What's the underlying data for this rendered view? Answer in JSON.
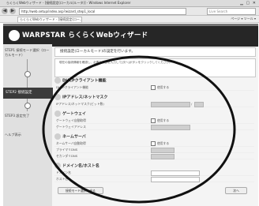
{
  "browser": {
    "title": "らくらくWebウィザード - [接続設定(ローカル(ルータ)] - Windows Internet Explorer",
    "address": "http://web.setup/index.asp?wizard_step1_local",
    "search_placeholder": "Live Search",
    "tab_label": "らくらくWebウィザード - [接続設定(ロー...",
    "tools": "ページ ▾  ツール ▾"
  },
  "app": {
    "title": "WARPSTAR らくらくWebウィザード",
    "sidebar": {
      "step1": "STEP1 接続モード選択（ローカルモード）",
      "step2": "STEP2 接続設定",
      "step3": "STEP3 設定完了",
      "help": "ヘルプ表示"
    },
    "content": {
      "title": "接続設定(ローカルモード)の設定を行います。",
      "intro": "現在の接続情報を確認し、必要な項目を入力して[次へ]ボタンをクリックしてください。",
      "sections": {
        "dhcp": {
          "title": "DHCPクライアント機能",
          "row_label": "DHCPクライアント機能",
          "row_value": "使用する"
        },
        "ip": {
          "title": "IPアドレス/ネットマスク",
          "row_label": "IPアドレス/ネットマスク(ビット数)",
          "slash": "/"
        },
        "gateway": {
          "title": "ゲートウェイ",
          "row1_label": "ゲートウェイ自動取得",
          "row1_value": "使用する",
          "row2_label": "ゲートウェイアドレス"
        },
        "dns": {
          "title": "ネームサーバ",
          "row1_label": "ネームサーバ自動取得",
          "row1_value": "使用する",
          "row2_label": "プライマリDNS",
          "row3_label": "セカンダリDNS"
        },
        "domain": {
          "title": "ドメイン名/ホスト名",
          "row1_label": "ドメイン名",
          "row2_label": "ホスト名"
        }
      },
      "back_button": "接続モード選択へ戻る",
      "next_button": "次へ"
    }
  }
}
